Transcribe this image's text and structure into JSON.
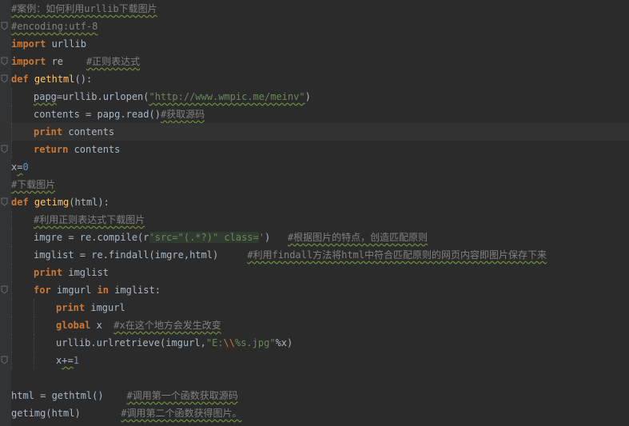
{
  "colors": {
    "background": "#2b2b2b",
    "gutter": "#313335",
    "keyword": "#cc7832",
    "string": "#6a8759",
    "comment": "#808080",
    "function_name": "#ffc66d",
    "number": "#6897bb",
    "text": "#a9b7c6"
  },
  "lines": [
    {
      "indent": 0,
      "tokens": [
        {
          "t": "#案例：如何利用urllib下载图片",
          "c": "cmt u"
        }
      ]
    },
    {
      "indent": 0,
      "fold": true,
      "tokens": [
        {
          "t": "#encoding:utf-8",
          "c": "cmt u"
        }
      ]
    },
    {
      "indent": 0,
      "tokens": [
        {
          "t": "import",
          "c": "kw"
        },
        {
          "t": " urllib",
          "c": "plain"
        }
      ]
    },
    {
      "indent": 0,
      "fold": true,
      "tokens": [
        {
          "t": "import",
          "c": "kw"
        },
        {
          "t": " re    ",
          "c": "plain"
        },
        {
          "t": "#正则表达式",
          "c": "cmt u"
        }
      ]
    },
    {
      "indent": 0,
      "fold": true,
      "tokens": [
        {
          "t": "def",
          "c": "kw"
        },
        {
          "t": " ",
          "c": "plain"
        },
        {
          "t": "gethtml",
          "c": "fn"
        },
        {
          "t": "():",
          "c": "plain"
        }
      ]
    },
    {
      "indent": 1,
      "tokens": [
        {
          "t": "papg",
          "c": "plain u"
        },
        {
          "t": "=urllib.urlopen(",
          "c": "plain"
        },
        {
          "t": "\"http://www.wmpic.me/meinv\"",
          "c": "str u"
        },
        {
          "t": ")",
          "c": "plain"
        }
      ]
    },
    {
      "indent": 1,
      "tokens": [
        {
          "t": "contents = papg.read()",
          "c": "plain"
        },
        {
          "t": "#获取源码",
          "c": "cmt u"
        }
      ]
    },
    {
      "indent": 1,
      "current": true,
      "tokens": [
        {
          "t": "print",
          "c": "kw"
        },
        {
          "t": " contents",
          "c": "plain"
        }
      ]
    },
    {
      "indent": 1,
      "fold": true,
      "tokens": [
        {
          "t": "return",
          "c": "kw"
        },
        {
          "t": " contents",
          "c": "plain"
        }
      ]
    },
    {
      "indent": 0,
      "tokens": [
        {
          "t": "x",
          "c": "plain"
        },
        {
          "t": "=",
          "c": "plain u"
        },
        {
          "t": "0",
          "c": "num"
        }
      ]
    },
    {
      "indent": 0,
      "tokens": [
        {
          "t": "#下载图片",
          "c": "cmt u"
        }
      ]
    },
    {
      "indent": 0,
      "fold": true,
      "tokens": [
        {
          "t": "def",
          "c": "kw"
        },
        {
          "t": " ",
          "c": "plain"
        },
        {
          "t": "getimg",
          "c": "fn"
        },
        {
          "t": "(html):",
          "c": "plain"
        }
      ]
    },
    {
      "indent": 1,
      "tokens": [
        {
          "t": "#利用正则表达式下载图片",
          "c": "cmt u"
        }
      ]
    },
    {
      "indent": 1,
      "tokens": [
        {
          "t": "imgre = re.compile(r",
          "c": "plain"
        },
        {
          "t": "'src=\"(.*?)\" class=",
          "c": "str regex-bg"
        },
        {
          "t": "'",
          "c": "str"
        },
        {
          "t": ")   ",
          "c": "plain"
        },
        {
          "t": "#根据图片的特点，创造匹配原则",
          "c": "cmt u"
        }
      ]
    },
    {
      "indent": 1,
      "tokens": [
        {
          "t": "imglist = re.findall(imgre,html)     ",
          "c": "plain"
        },
        {
          "t": "#利用findall方法将html中符合匹配原则的网页内容即图片保存下来",
          "c": "cmt u"
        }
      ]
    },
    {
      "indent": 1,
      "tokens": [
        {
          "t": "print",
          "c": "kw"
        },
        {
          "t": " imglist",
          "c": "plain"
        }
      ]
    },
    {
      "indent": 1,
      "fold": true,
      "tokens": [
        {
          "t": "for",
          "c": "kw"
        },
        {
          "t": " imgurl ",
          "c": "plain"
        },
        {
          "t": "in",
          "c": "kw"
        },
        {
          "t": " imglist:",
          "c": "plain"
        }
      ]
    },
    {
      "indent": 2,
      "tokens": [
        {
          "t": "print",
          "c": "kw"
        },
        {
          "t": " imgurl",
          "c": "plain"
        }
      ]
    },
    {
      "indent": 2,
      "tokens": [
        {
          "t": "global",
          "c": "kw"
        },
        {
          "t": " x  ",
          "c": "plain"
        },
        {
          "t": "#x在这个地方会发生改变",
          "c": "cmt u"
        }
      ]
    },
    {
      "indent": 2,
      "tokens": [
        {
          "t": "urllib.urlretrieve(imgurl,",
          "c": "plain"
        },
        {
          "t": "\"E:",
          "c": "str"
        },
        {
          "t": "\\\\",
          "c": "escape"
        },
        {
          "t": "%s.jpg\"",
          "c": "str"
        },
        {
          "t": "%x)",
          "c": "plain"
        }
      ]
    },
    {
      "indent": 2,
      "fold": true,
      "tokens": [
        {
          "t": "x",
          "c": "plain"
        },
        {
          "t": "+=",
          "c": "plain u"
        },
        {
          "t": "1",
          "c": "num"
        }
      ]
    },
    {
      "indent": 0,
      "tokens": []
    },
    {
      "indent": 0,
      "tokens": [
        {
          "t": "html = gethtml()    ",
          "c": "plain"
        },
        {
          "t": "#调用第一个函数获取源码",
          "c": "cmt u"
        }
      ]
    },
    {
      "indent": 0,
      "tokens": [
        {
          "t": "getimg(html)       ",
          "c": "plain"
        },
        {
          "t": "#调用第二个函数获得图片。",
          "c": "cmt u"
        }
      ]
    }
  ]
}
